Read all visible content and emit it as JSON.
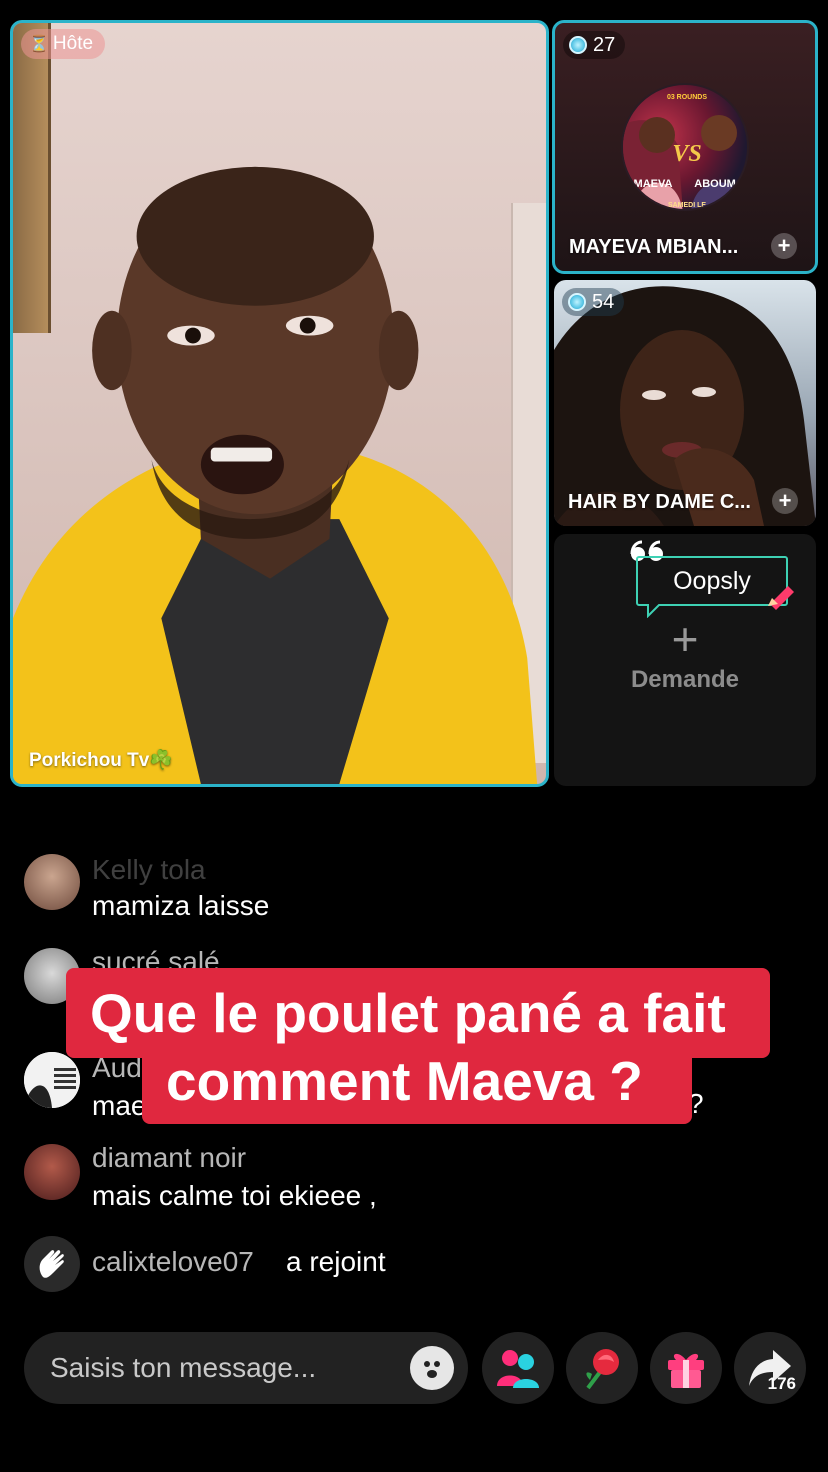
{
  "host": {
    "badge_label": "Hôte",
    "name": "Porkichou Tv☘️"
  },
  "guests": [
    {
      "viewers": "27",
      "name": "MAYEVA MBIAN...",
      "poster_text": {
        "top": "03 ROUNDS",
        "vs": "VS",
        "left": "MAEVA",
        "right": "ABOUMA",
        "bottom": "SAMEDI LE"
      }
    },
    {
      "viewers": "54",
      "name": "HAIR BY DAME C..."
    }
  ],
  "request_tile": {
    "bubble_text": "Oopsly",
    "plus": "+",
    "label": "Demande"
  },
  "chat": {
    "messages": [
      {
        "user": "Kelly tola",
        "text": "mamiza laisse"
      },
      {
        "user": "sucré salé",
        "text": ""
      },
      {
        "user": "Aud",
        "text": "mae"
      },
      {
        "user": "diamant noir",
        "text": "mais calme toi ekieee ,"
      }
    ],
    "join": {
      "user": "calixtelove07",
      "action": "a rejoint"
    },
    "partial_char": "?"
  },
  "caption": {
    "line1": "Que le poulet pané a fait",
    "line2": "comment Maeva ?"
  },
  "bottom_bar": {
    "input_placeholder": "Saisis ton message...",
    "share_count": "176"
  },
  "colors": {
    "accent_teal": "#2bb3c9",
    "caption_red": "#e0283f",
    "bubble_green": "#3ed1b4",
    "co_host_pink": "#ff2e7a",
    "co_host_cyan": "#2ad2e0"
  },
  "icons": [
    "hourglass-icon",
    "gem-icon",
    "plus-icon",
    "quote-icon",
    "pencil-icon",
    "emoji-icon",
    "co-host-icon",
    "rose-icon",
    "gift-icon",
    "share-icon",
    "wave-icon"
  ]
}
